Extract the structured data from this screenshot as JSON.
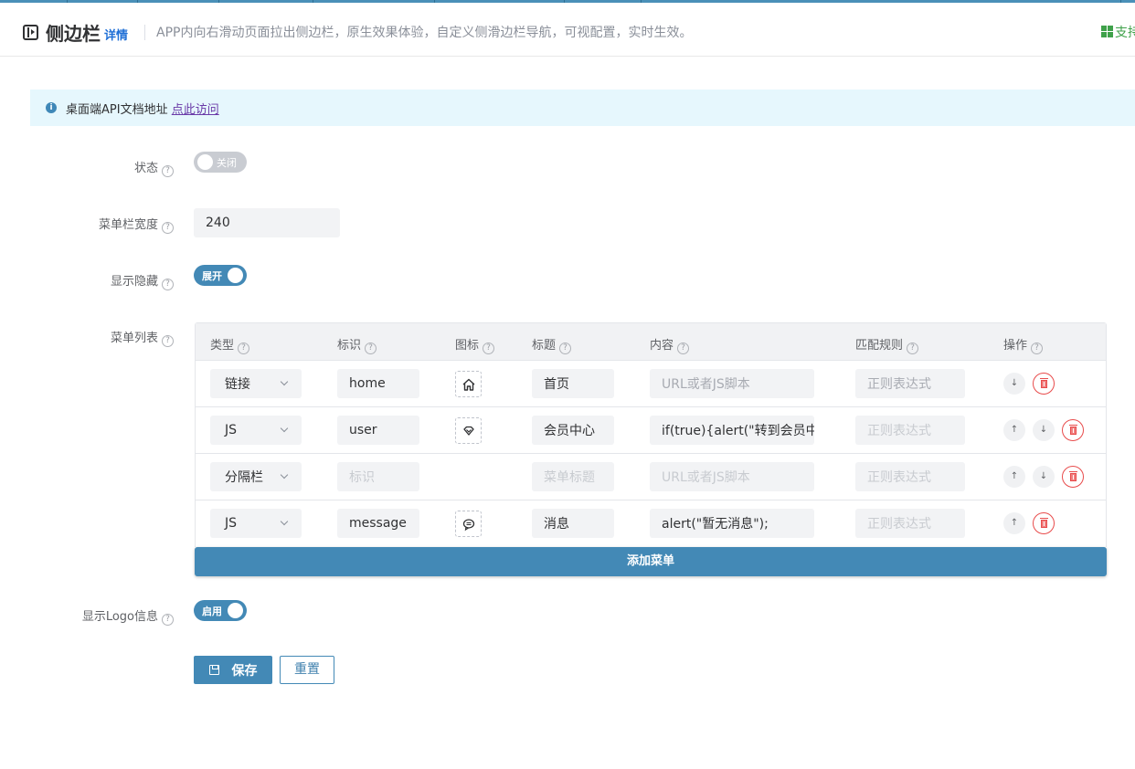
{
  "header": {
    "title": "侧边栏",
    "detail_link": "详情",
    "description": "APP内向右滑动页面拉出侧边栏，原生效果体验，自定义侧滑边栏导航，可视配置，实时生效。",
    "support_label": "支持",
    "support_icon": "windows-icon"
  },
  "notice": {
    "icon": "info-icon",
    "text": "桌面端API文档地址",
    "link_text": "点此访问"
  },
  "form": {
    "status": {
      "label": "状态",
      "switch_text": "关闭",
      "on": false
    },
    "menu_width": {
      "label": "菜单栏宽度",
      "value": "240"
    },
    "show_hide": {
      "label": "显示隐藏",
      "switch_text": "展开",
      "on": true
    },
    "menu_list": {
      "label": "菜单列表"
    },
    "show_logo": {
      "label": "显示Logo信息",
      "switch_text": "启用",
      "on": true
    }
  },
  "menu_table": {
    "columns": [
      "类型",
      "标识",
      "图标",
      "标题",
      "内容",
      "匹配规则",
      "操作"
    ],
    "rows": [
      {
        "type": "链接",
        "id": "home",
        "id_placeholder": "标识",
        "icon": "home-icon",
        "title": "首页",
        "title_placeholder": "菜单标题",
        "content": "",
        "content_placeholder": "URL或者JS脚本",
        "rule": "",
        "rule_placeholder": "正则表达式",
        "ops": [
          "down",
          "delete"
        ]
      },
      {
        "type": "JS",
        "id": "user",
        "id_placeholder": "标识",
        "icon": "diamond-icon",
        "title": "会员中心",
        "title_placeholder": "菜单标题",
        "content": "if(true){alert(\"转到会员中心\")}",
        "content_placeholder": "URL或者JS脚本",
        "rule": "",
        "rule_placeholder": "正则表达式",
        "ops": [
          "up",
          "down",
          "delete"
        ]
      },
      {
        "type": "分隔栏",
        "id": "",
        "id_placeholder": "标识",
        "icon": "",
        "title": "",
        "title_placeholder": "菜单标题",
        "content": "",
        "content_placeholder": "URL或者JS脚本",
        "rule": "",
        "rule_placeholder": "正则表达式",
        "ops": [
          "up",
          "down",
          "delete"
        ]
      },
      {
        "type": "JS",
        "id": "message",
        "id_placeholder": "标识",
        "icon": "message-icon",
        "title": "消息",
        "title_placeholder": "菜单标题",
        "content": "alert(\"暂无消息\");",
        "content_placeholder": "URL或者JS脚本",
        "rule": "",
        "rule_placeholder": "正则表达式",
        "ops": [
          "up",
          "delete"
        ]
      }
    ],
    "add_button": "添加菜单"
  },
  "actions": {
    "save_label": "保存",
    "reset_label": "重置"
  },
  "colors": {
    "primary": "#4389b6",
    "danger": "#e84b4b",
    "link": "#1f6fd6",
    "support_green": "#3fa14a"
  }
}
